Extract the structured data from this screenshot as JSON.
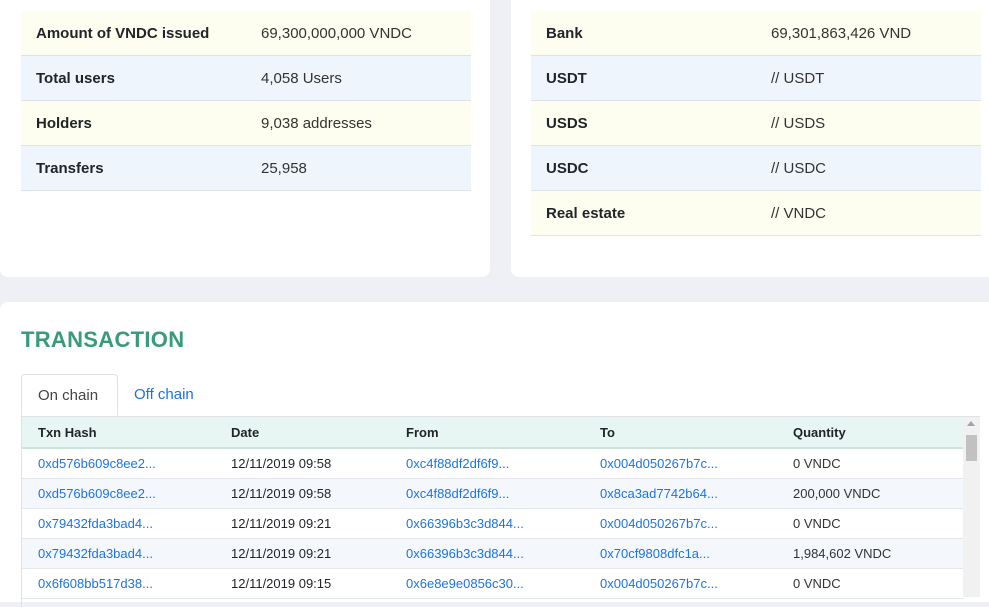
{
  "stats_left": [
    {
      "label": "Amount of VNDC issued",
      "value": "69,300,000,000 VNDC"
    },
    {
      "label": "Total users",
      "value": "4,058 Users"
    },
    {
      "label": "Holders",
      "value": "9,038 addresses"
    },
    {
      "label": "Transfers",
      "value": "25,958"
    }
  ],
  "stats_right": [
    {
      "label": "Bank",
      "value": "69,301,863,426 VND"
    },
    {
      "label": "USDT",
      "value": "// USDT"
    },
    {
      "label": "USDS",
      "value": "// USDS"
    },
    {
      "label": "USDC",
      "value": "// USDC"
    },
    {
      "label": "Real estate",
      "value": "// VNDC"
    }
  ],
  "transaction": {
    "title": "TRANSACTION",
    "tabs": [
      "On chain",
      "Off chain"
    ],
    "columns": [
      "Txn Hash",
      "Date",
      "From",
      "To",
      "Quantity"
    ],
    "rows": [
      {
        "hash": "0xd576b609c8ee2...",
        "date": "12/11/2019 09:58",
        "from": "0xc4f88df2df6f9...",
        "to": "0x004d050267b7c...",
        "qty": "0 VNDC"
      },
      {
        "hash": "0xd576b609c8ee2...",
        "date": "12/11/2019 09:58",
        "from": "0xc4f88df2df6f9...",
        "to": "0x8ca3ad7742b64...",
        "qty": "200,000 VNDC"
      },
      {
        "hash": "0x79432fda3bad4...",
        "date": "12/11/2019 09:21",
        "from": "0x66396b3c3d844...",
        "to": "0x004d050267b7c...",
        "qty": "0 VNDC"
      },
      {
        "hash": "0x79432fda3bad4...",
        "date": "12/11/2019 09:21",
        "from": "0x66396b3c3d844...",
        "to": "0x70cf9808dfc1a...",
        "qty": "1,984,602 VNDC"
      },
      {
        "hash": "0x6f608bb517d38...",
        "date": "12/11/2019 09:15",
        "from": "0x6e8e9e0856c30...",
        "to": "0x004d050267b7c...",
        "qty": "0 VNDC"
      }
    ]
  },
  "colors": {
    "accent": "#3a9b7b",
    "link": "#1a73e8",
    "header_bg": "#e7f6f3",
    "row_yellow": "#fefef0",
    "row_blue": "#eef5fc"
  }
}
